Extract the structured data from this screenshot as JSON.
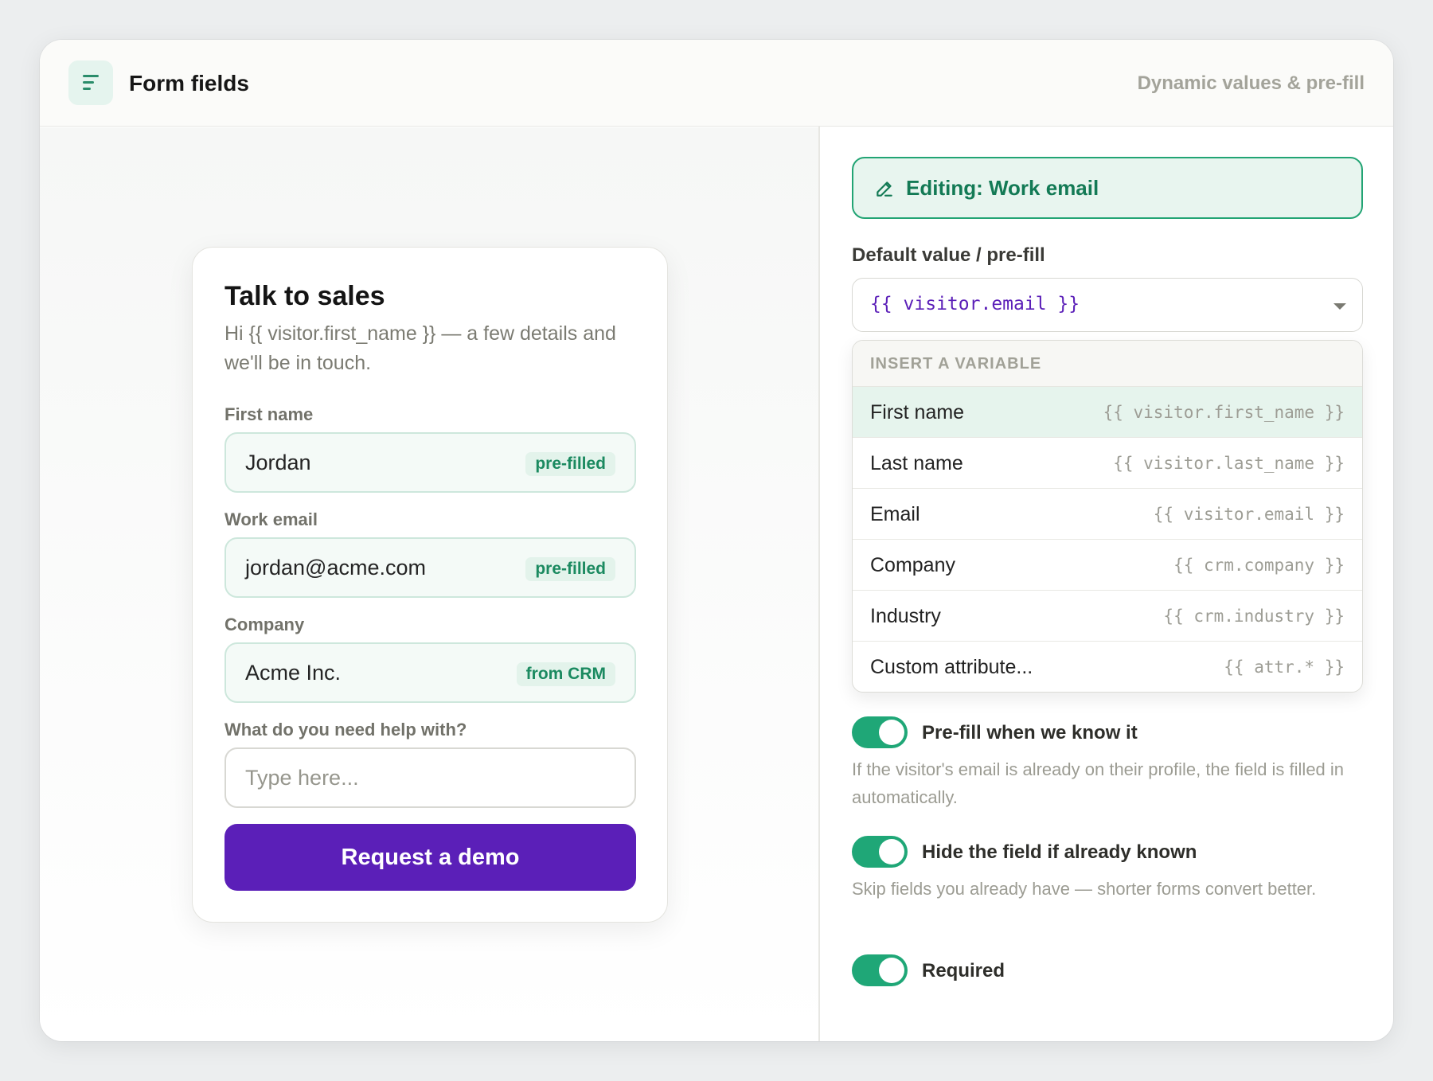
{
  "header": {
    "title": "Form fields",
    "subtitle": "Dynamic values & pre-fill",
    "icon": "text-align-left-icon"
  },
  "form": {
    "title": "Talk to sales",
    "subtitle": "Hi {{ visitor.first_name }} — a few details and we'll be in touch.",
    "fields": [
      {
        "label": "First name",
        "value": "Jordan",
        "badge": "pre-filled"
      },
      {
        "label": "Work email",
        "value": "jordan@acme.com",
        "badge": "pre-filled"
      },
      {
        "label": "Company",
        "value": "Acme Inc.",
        "badge": "from CRM"
      },
      {
        "label": "What do you need help with?",
        "placeholder": "Type here..."
      }
    ],
    "submit_label": "Request a demo",
    "submit_color": "#5b1fb8"
  },
  "editor": {
    "editing_label": "Editing: Work email",
    "editing_icon": "pencil-icon",
    "default_label": "Default value / pre-fill",
    "default_value": "{{ visitor.email }}",
    "dropdown": {
      "header": "INSERT A VARIABLE",
      "items": [
        {
          "name": "First name",
          "code": "{{ visitor.first_name }}"
        },
        {
          "name": "Last name",
          "code": "{{ visitor.last_name }}"
        },
        {
          "name": "Email",
          "code": "{{ visitor.email }}"
        },
        {
          "name": "Company",
          "code": "{{ crm.company }}"
        },
        {
          "name": "Industry",
          "code": "{{ crm.industry }}"
        },
        {
          "name": "Custom attribute...",
          "code": "{{ attr.* }}"
        }
      ]
    },
    "toggles": [
      {
        "label": "Pre-fill when we know it",
        "on": true,
        "desc": "If the visitor's email is already on their profile, the field is filled in automatically."
      },
      {
        "label": "Hide the field if already known",
        "on": true,
        "desc": "Skip fields you already have — shorter forms convert better."
      },
      {
        "label": "Required",
        "on": true
      }
    ],
    "accent_color": "#1fa777"
  }
}
